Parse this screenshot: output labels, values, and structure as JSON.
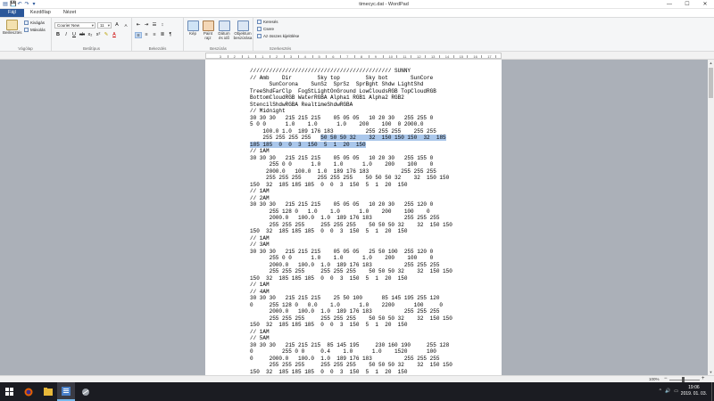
{
  "window": {
    "title": "timecyc.dat - WordPad",
    "minimize": "—",
    "maximize": "☐",
    "close": "✕"
  },
  "tabs": [
    "Fájl",
    "Kezdőlap",
    "Nézet"
  ],
  "ribbon": {
    "clipboard": {
      "paste": "Beillesztés",
      "cut": "Kivágás",
      "copy": "Másolás",
      "group": "Vágólap"
    },
    "font": {
      "family": "Courier New",
      "size": "11",
      "group": "Betűtípus"
    },
    "paragraph": {
      "group": "Bekezdés"
    },
    "insert": {
      "picture": "Kép",
      "paint": "Paint rajz",
      "datetime": "Dátum és idő",
      "object": "Objektum beszúrása",
      "group": "Beszúrás"
    },
    "editing": {
      "find": "Keresés",
      "replace": "Csere",
      "select_all": "Az összes kijelölése",
      "group": "Szerkesztés"
    }
  },
  "ruler": {
    "labels": [
      "3",
      "2",
      "1",
      "1",
      "2",
      "3",
      "4",
      "5",
      "6",
      "7",
      "8",
      "9",
      "10",
      "11",
      "12",
      "13",
      "14",
      "15",
      "16",
      "17"
    ]
  },
  "document": {
    "before_selection": "//////////////////////////////////////////// SUNNY\n// Amb    Dir        Sky top        Sky bot       SunCore\n      SunCorona    SunSz  SprSz  SprBght Shdw LightShd\nTreeShdFarClp  FogStLightOnGround LowCloudsRGB TopCloudRGB\nBottomCloudRGB WaterRGBA Alpha1 RGB1 Alpha2 RGB2\nStencilShdwRGBA RealtimeShdwRGBA\n// Midnight\n30 30 30   215 215 215    05 05 05   10 20 30   255 255 0\n5 0 0      1.0    1.0      1.0    200    100  0 2000.0\n    100.0 1.0  189 176 183          255 255 255    255 255\n    255 255 255 255   ",
    "selection": "50 50 50 32    32  150 150 150  32  185\n185 185  0  0  3  150  5  1  20  150",
    "after_selection": "\n// 1AM\n30 30 30   215 215 215    05 05 05   10 20 30   255 155 0\n      255 0 0      1.0    1.0      1.0    200    100    0\n     2000.0   100.0  1.0  189 176 183          255 255 255\n     255 255 255     255 255 255    50 50 50 32    32  150 150\n150  32  185 185 185  0  0  3  150  5  1  20  150\n// 1AM\n// 2AM\n30 30 30   215 215 215    05 05 05   10 20 30   255 120 0\n      255 128 0   1.0    1.0      1.0    200    100    0\n      2000.0   100.0  1.0  189 176 183          255 255 255\n      255 255 255     255 255 255    50 50 50 32    32  150 150\n150  32  185 185 185  0  0  3  150  5  1  20  150\n// 1AM\n// 3AM\n30 30 30   215 215 215    05 05 05   25 50 100  255 120 0\n      255 0 0      1.0    1.0      1.0    200    100    0\n      2000.0   100.0  1.0  189 176 183          255 255 255\n      255 255 255     255 255 255    50 50 50 32    32  150 150\n150  32  185 185 185  0  0  3  150  5  1  20  150\n// 1AM\n// 4AM\n30 30 30   215 215 215    25 50 100      85 145 195 255 120\n0     255 128 0   0.0    1.0      1.0    2200      100     0\n      2000.0   100.0  1.0  189 176 183          255 255 255\n      255 255 255     255 255 255    50 50 50 32    32  150 150\n150  32  185 185 185  0  0  3  150  5  1  20  150\n// 1AM\n// 5AM\n30 30 30   215 215 215  85 145 195     230 160 190     255 128\n0         255 0 0     0.4    1.0      1.0    1520      100\n0     2000.0   100.0  1.0  189 176 183          255 255 255\n      255 255 255     255 255 255    50 50 50 32    32  150 150\n150  32  185 185 185  0  0  3  150  5  1  20  150\n// 1AM\n// 6AM\n30 30 30   215 215 215  230 160 190     255 225 130    255 128"
  },
  "status": {
    "zoom": "100%",
    "minus": "−",
    "plus": "+"
  },
  "taskbar": {
    "time": "19:06",
    "date": "2019. 01. 03.",
    "tray": [
      "^",
      "🔊",
      "▭"
    ]
  }
}
